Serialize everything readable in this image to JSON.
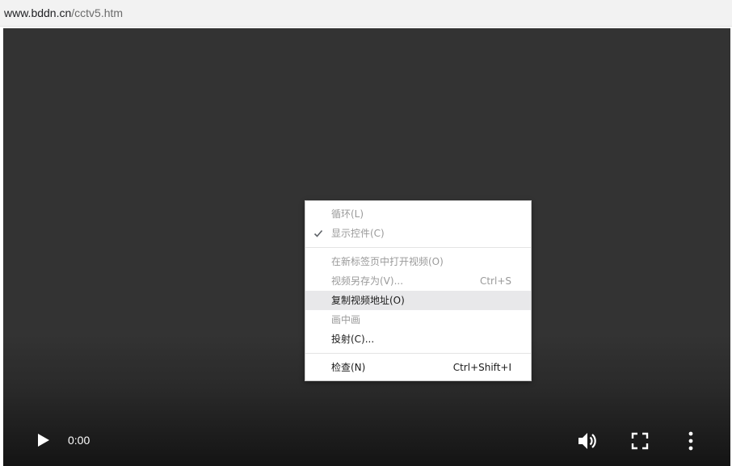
{
  "address_bar": {
    "host": "www.bddn.cn",
    "path": "/cctv5.htm"
  },
  "video": {
    "time": "0:00",
    "controls": {
      "play_icon": "play-icon",
      "volume_icon": "volume-icon",
      "fullscreen_icon": "fullscreen-icon",
      "more_icon": "more-vertical-icon"
    }
  },
  "context_menu": {
    "loop": "循环(L)",
    "show_controls": "显示控件(C)",
    "open_new_tab": "在新标签页中打开视频(O)",
    "save_video": "视频另存为(V)...",
    "save_video_shortcut": "Ctrl+S",
    "copy_address": "复制视频地址(O)",
    "pip": "画中画",
    "cast": "投射(C)...",
    "inspect": "检查(N)",
    "inspect_shortcut": "Ctrl+Shift+I"
  },
  "colors": {
    "video_bg": "#333333",
    "menu_bg": "#ffffff",
    "menu_disabled_text": "#9a9a9a",
    "menu_enabled_text": "#1b1b1b",
    "menu_hover": "#e8e8ea"
  }
}
